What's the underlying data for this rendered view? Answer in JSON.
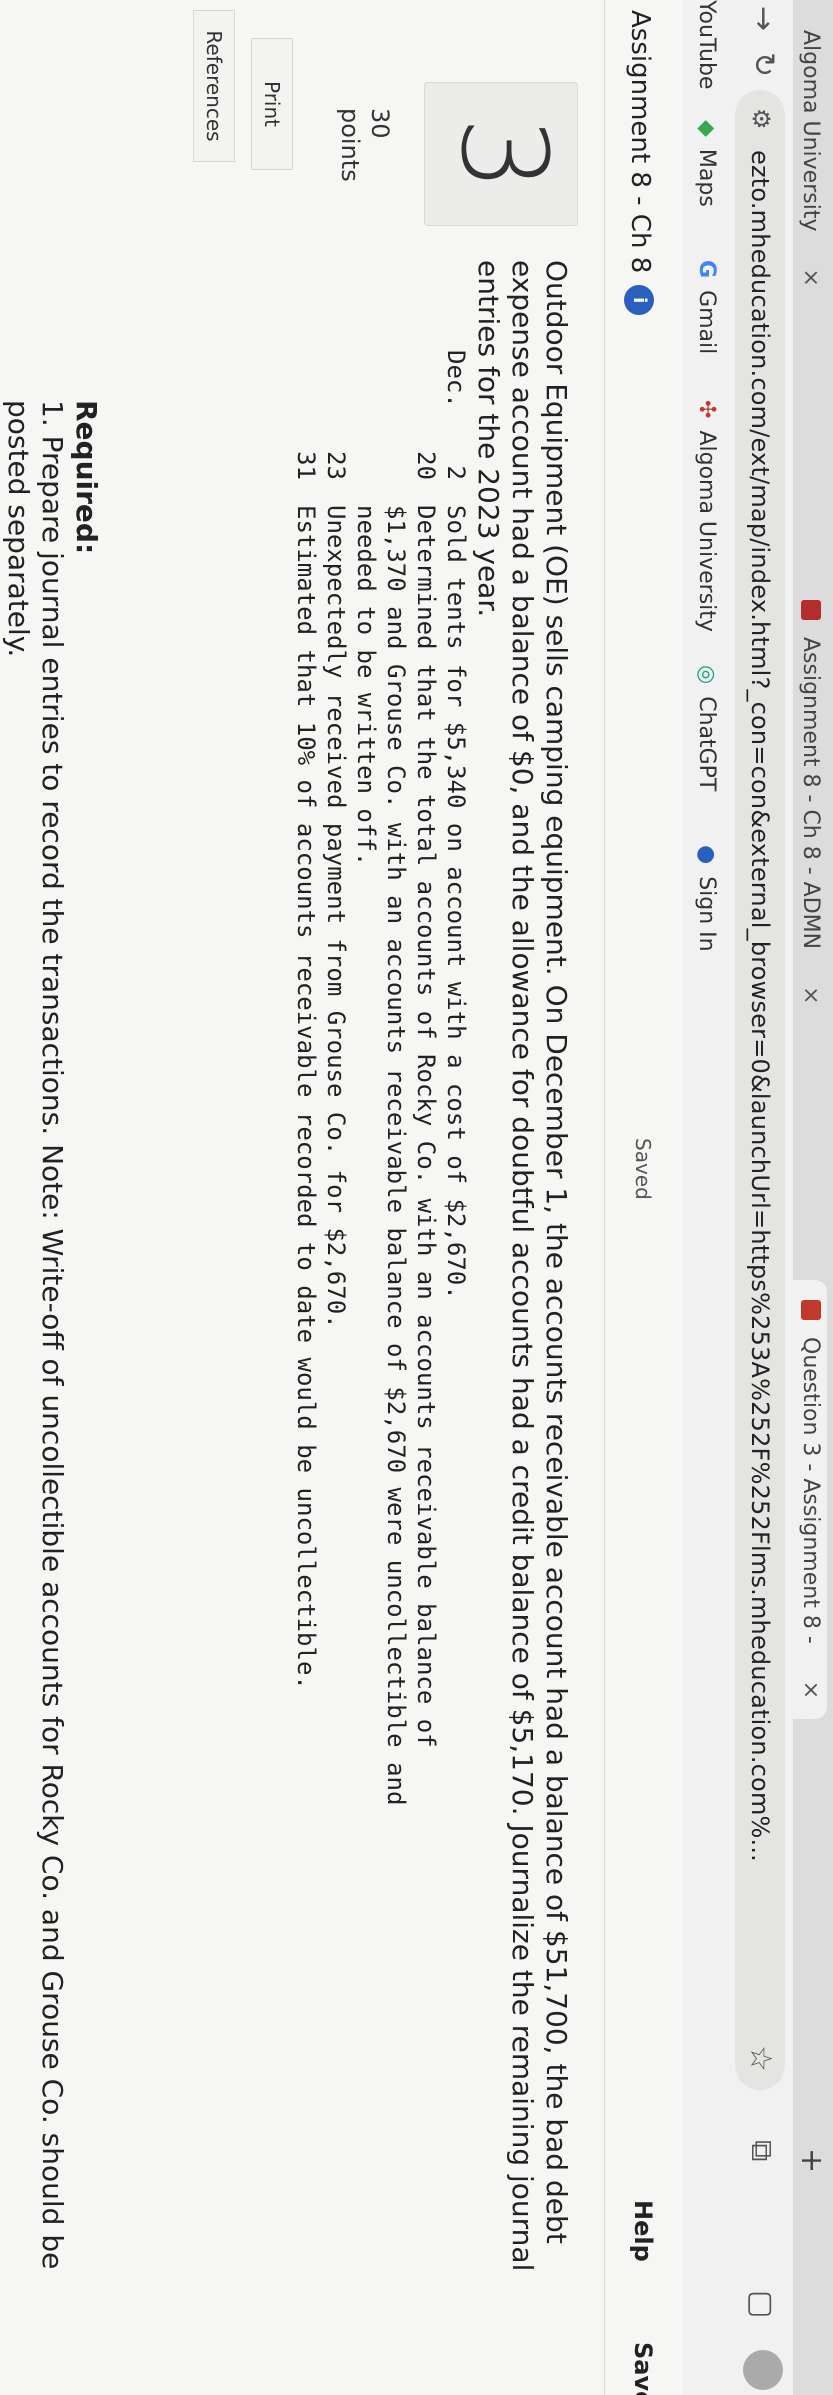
{
  "browser": {
    "tabs": [
      {
        "label": "Algoma University",
        "close": "×"
      },
      {
        "label": "Assignment 8 - Ch 8 - ADMN",
        "close": "×"
      },
      {
        "label": "Question 3 - Assignment 8 -",
        "close": "×"
      }
    ],
    "new_tab": "+",
    "url": "ezto.mheducation.com/ext/map/index.html?_con=con&external_browser=0&launchUrl=https%253A%252F%252Flms.mheducation.com%...",
    "bookmarks": [
      "YouTube",
      "Maps",
      "Gmail",
      "Algoma University",
      "ChatGPT",
      "Sign In"
    ]
  },
  "header": {
    "assignment_title": "Assignment 8 - Ch 8",
    "info_badge": "i",
    "saved": "Saved",
    "help": "Help",
    "save_exit": "Save & Ex"
  },
  "question": {
    "number": "3",
    "points_value": "30",
    "points_label": "points",
    "print_label": "Print",
    "references_label": "References",
    "prompt": "Outdoor Equipment (OE) sells camping equipment. On December 1, the accounts receivable account had a balance of $51,700, the bad debt expense account had a balance of $0, and the allowance for doubtful accounts had a credit balance of $5,170. Journalize the remaining journal entries for the 2023 year.",
    "transactions": [
      {
        "month": "Dec.",
        "day": "2",
        "text": "Sold tents for $5,340 on account with a cost of $2,670."
      },
      {
        "month": "",
        "day": "20",
        "text": "Determined that the total accounts of Rocky Co. with an accounts receivable balance of\n$1,370 and Grouse Co. with an accounts receivable balance of $2,670 were uncollectible and\nneeded to be written off."
      },
      {
        "month": "",
        "day": "23",
        "text": "Unexpectedly received payment from Grouse Co. for $2,670."
      },
      {
        "month": "",
        "day": "31",
        "text": "Estimated that 10% of accounts receivable recorded to date would be uncollectible."
      }
    ],
    "required_label": "Required:",
    "required_text": "1. Prepare journal entries to record the transactions. Note: Write-off of uncollectible accounts for Rocky Co. and Grouse Co. should be posted separately."
  }
}
